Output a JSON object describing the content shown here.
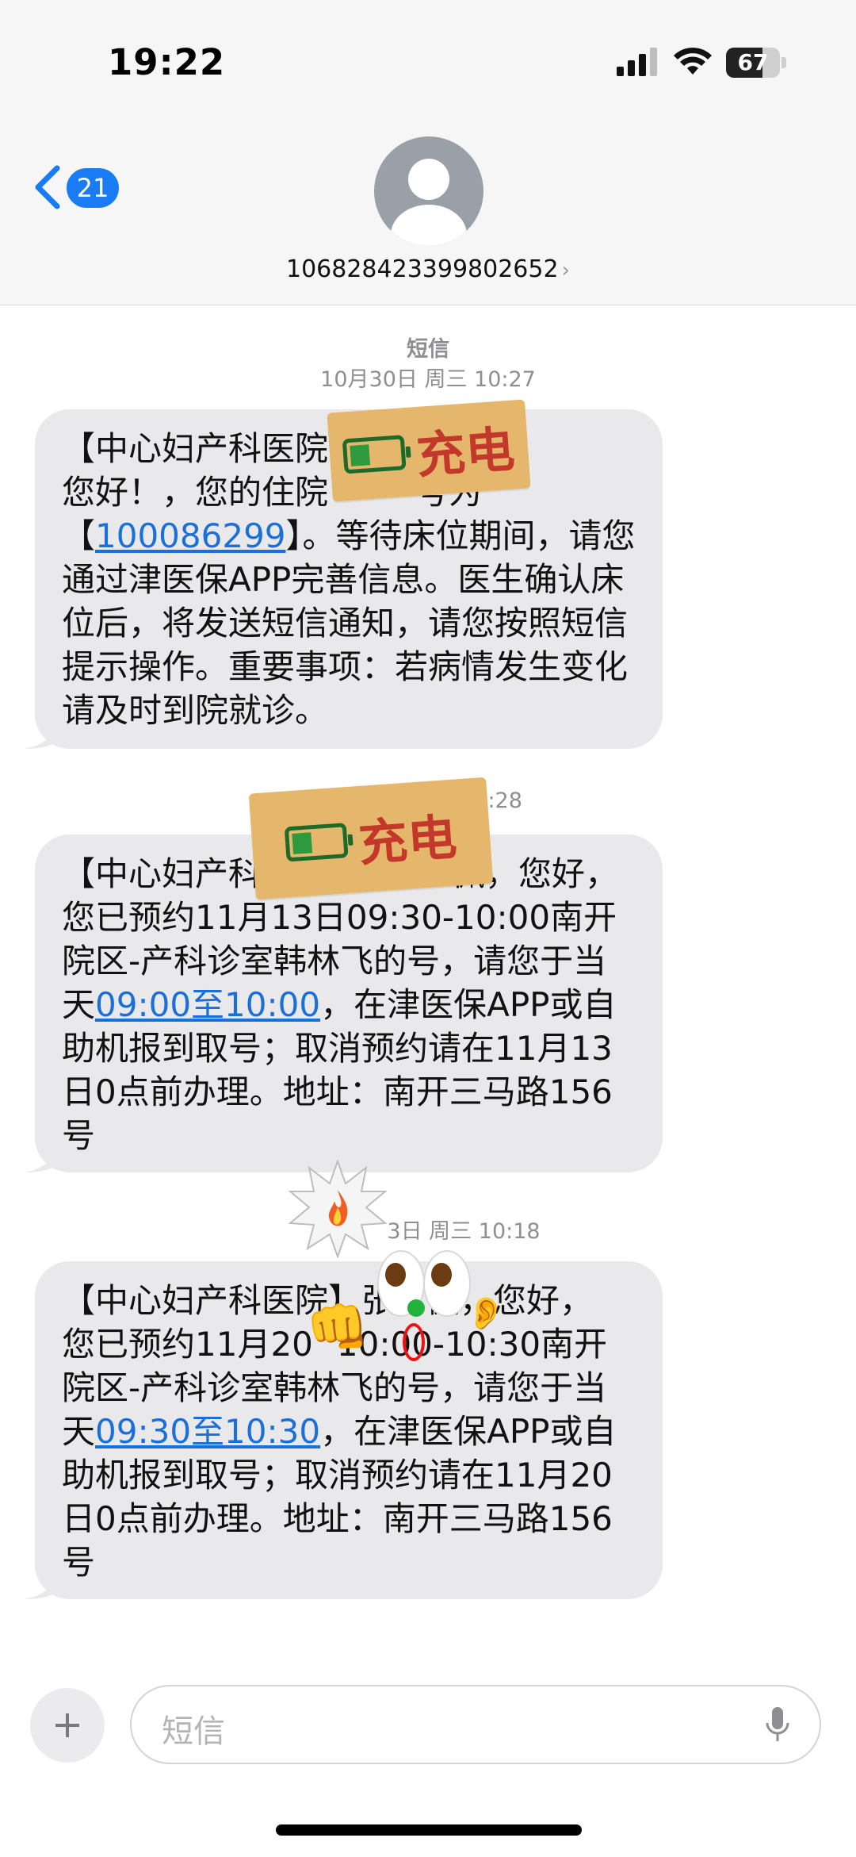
{
  "status": {
    "time": "19:22",
    "battery": "67",
    "battery_level": 0.67,
    "icons": [
      "cellular-signal-icon",
      "wifi-icon",
      "battery-icon"
    ]
  },
  "header": {
    "back_count": "21",
    "contact": "106828423399802652",
    "icons": [
      "chevron-left-icon",
      "avatar-icon",
      "chevron-right-icon"
    ]
  },
  "thread": {
    "service": "短信",
    "stamp1": "10月30日 周三 10:27",
    "stamp2": "09:28",
    "stamp3": "3日 周三 10:18",
    "messages": [
      {
        "part1": "【中心妇产科医院",
        "part2": "您好！，您的住院",
        "part3": "号为",
        "part4": "【",
        "link": "100086299",
        "part5": "】。等待床位期间，请您通过津医保APP完善信息。医生确认床位后，将发送短信通知，请您按照短信提示操作。重要事项：若病情发生变化请及时到院就诊。"
      },
      {
        "part1": "【中心妇产科",
        "part2": "佩，您好，",
        "part3": "您已预约11月13日09:30-10:00南开院区-产科诊室韩林飞的号，请您于当天",
        "link": "09:00至10:00",
        "part4": "，在津医保APP或自助机报到取号；取消预约请在11月13日0点前办理。地址：南开三马路156号"
      },
      {
        "part1": "【中心妇产科医院】",
        "part2": "张",
        "part3": "佩，您好，",
        "part4": "您已预约11月20",
        "part5": "10:00-10:30南开院区-产科诊室韩林飞的号，请您于当天",
        "link": "09:30至10:30",
        "part6": "，在津医保APP或自助机报到取号；取消预约请在11月20日0点前办理。地址：南开三马路156号"
      }
    ]
  },
  "stickers": {
    "charge_text": "充电",
    "icons": [
      "battery-low-sticker-icon",
      "fire-burst-icon",
      "googly-eyes-icon",
      "fist-icon",
      "ear-icon"
    ]
  },
  "composer": {
    "placeholder": "短信",
    "icons": [
      "plus-icon",
      "microphone-icon"
    ]
  }
}
